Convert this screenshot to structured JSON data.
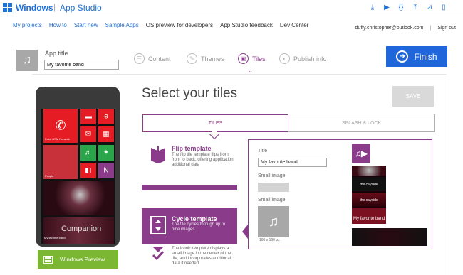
{
  "topbar": {
    "brand": "Windows",
    "separator": "|",
    "product": "App Studio",
    "icons": [
      "download-icon",
      "play-icon",
      "code-icon",
      "upload-icon",
      "chart-icon",
      "phone-icon"
    ]
  },
  "nav": {
    "items": [
      "My projects",
      "How to",
      "Start new",
      "Sample Apps",
      "OS preview for developers",
      "App Studio feedback",
      "Dev Center"
    ]
  },
  "user": {
    "email": "duffy.christopher@outlook.com",
    "separator": "|",
    "signout": "Sign out"
  },
  "app": {
    "title_label": "App title",
    "title_value": "My favorite band"
  },
  "steps": [
    {
      "label": "Content",
      "icon": "content-icon",
      "active": false
    },
    {
      "label": "Themes",
      "icon": "themes-icon",
      "active": false
    },
    {
      "label": "Tiles",
      "icon": "tiles-icon",
      "active": true
    },
    {
      "label": "Publish info",
      "icon": "publish-icon",
      "active": false
    }
  ],
  "finish_label": "Finish",
  "phone": {
    "network": "Fake GSM Network",
    "tile_label": "People",
    "companion": "Companion",
    "favorite": "My favorite band"
  },
  "windows_preview_label": "Windows Preview",
  "main": {
    "heading": "Select your tiles",
    "save_label": "SAVE",
    "tabs": [
      "TILES",
      "SPLASH & LOCK"
    ]
  },
  "templates": [
    {
      "name": "Flip template",
      "description": "The flip tile template flips from front to back, offering application additional data"
    },
    {
      "name": "Cycle template",
      "description": "The tile cycles through up to nine images"
    },
    {
      "name": "",
      "description": "The iconic template displays a small image in the center of the tile, and incorporates additional data if needed"
    }
  ],
  "panel": {
    "title_label": "Title",
    "title_value": "My favorite band",
    "small_image_label_1": "Small image",
    "small_image_label_2": "Small image",
    "size_label": "160 x 160 px",
    "preview_label": "My favorite band",
    "preview_caption_1": "the cayside",
    "preview_caption_2": "the cayside"
  },
  "colors": {
    "accent": "#8a3c8a",
    "blue": "#1e66d9",
    "green": "#7cb733",
    "red": "#e51c23"
  }
}
